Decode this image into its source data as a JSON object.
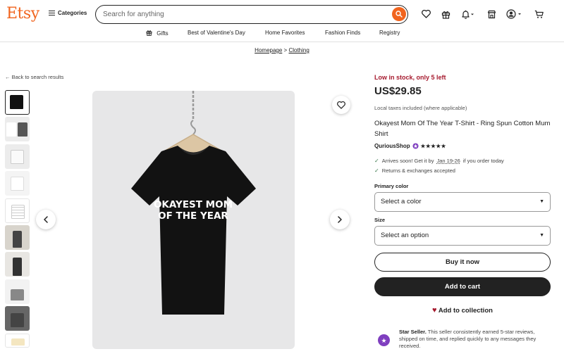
{
  "header": {
    "logo": "Etsy",
    "categories_label": "Categories",
    "search_placeholder": "Search for anything"
  },
  "nav": {
    "items": [
      "Gifts",
      "Best of Valentine's Day",
      "Home Favorites",
      "Fashion Finds",
      "Registry"
    ]
  },
  "breadcrumb": {
    "items": [
      "Homepage",
      "Clothing"
    ],
    "separator": ">"
  },
  "back_link": "Back to search results",
  "product": {
    "image_text_line1": "OKAYEST MOM",
    "image_text_line2": "OF THE YEAR",
    "stock": "Low in stock, only 5 left",
    "price": "US$29.85",
    "tax_note": "Local taxes included (where applicable)",
    "title": "Okayest Mom Of The Year T-Shirt - Ring Spun Cotton Mum Shirt",
    "shop_name": "QuriousShop",
    "rating_stars": "★★★★★",
    "arrival_prefix": "Arrives soon! Get it by",
    "arrival_dates": "Jan 19-26",
    "arrival_suffix": "if you order today",
    "returns": "Returns & exchanges accepted"
  },
  "options": {
    "color_label": "Primary color",
    "color_value": "Select a color",
    "size_label": "Size",
    "size_value": "Select an option"
  },
  "buttons": {
    "buy_now": "Buy it now",
    "add_to_cart": "Add to cart",
    "add_to_collection": "Add to collection"
  },
  "star_seller": {
    "title": "Star Seller.",
    "text": "This seller consistently earned 5-star reviews, shipped on time, and replied quickly to any messages they received."
  },
  "colors": {
    "brand": "#f1641e",
    "stock_red": "#a61a2e",
    "dark": "#222222",
    "star_seller_purple": "#7f3fbf"
  }
}
